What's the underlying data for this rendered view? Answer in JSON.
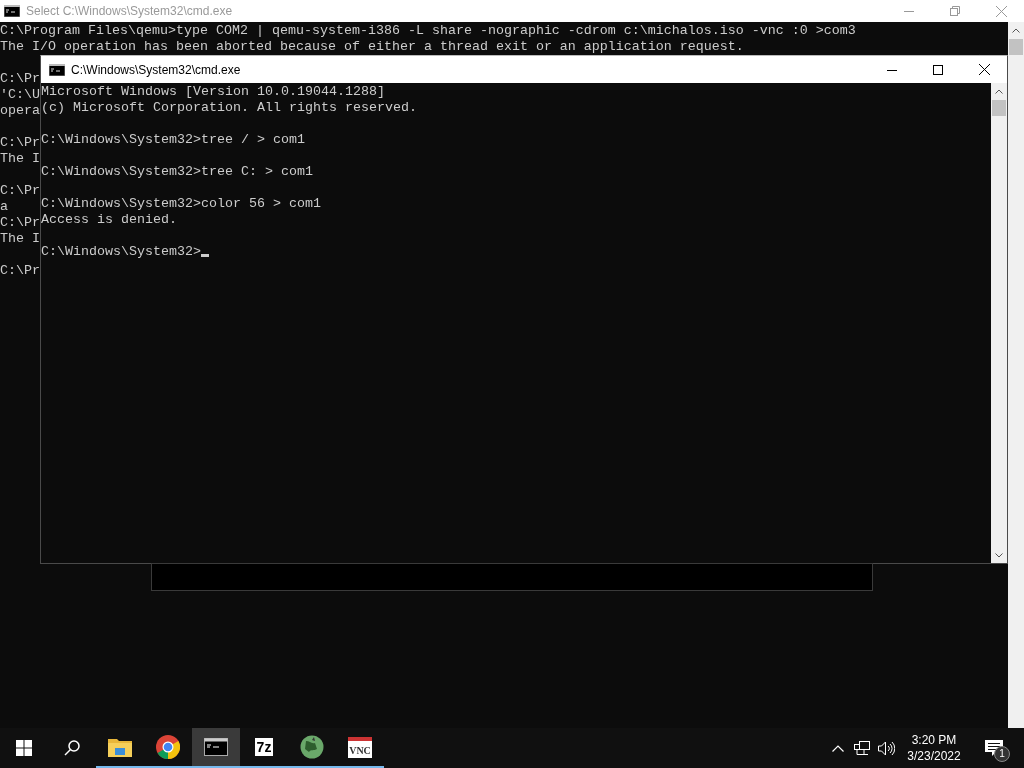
{
  "background_window": {
    "title": "Select C:\\Windows\\System32\\cmd.exe",
    "active": false,
    "blocks": [
      [
        "C:\\Program Files\\qemu>type COM2 | qemu-system-i386 -L share -nographic -cdrom c:\\michalos.iso -vnc :0 >com3",
        "The I/O operation has been aborted because of either a thread exit or an application request."
      ],
      [
        "C:\\Pr",
        "'C:\\U",
        "opera"
      ],
      [
        "C:\\Pr",
        "The I"
      ],
      [
        "C:\\Pr",
        "a",
        "C:\\Pr",
        "The I"
      ],
      [
        "C:\\Pr"
      ]
    ]
  },
  "front_window": {
    "title": "C:\\Windows\\System32\\cmd.exe",
    "active": true,
    "cursor": true,
    "blocks": [
      [
        "Microsoft Windows [Version 10.0.19044.1288]",
        "(c) Microsoft Corporation. All rights reserved."
      ],
      [
        "C:\\Windows\\System32>tree / > com1"
      ],
      [
        "C:\\Windows\\System32>tree C: > com1"
      ],
      [
        "C:\\Windows\\System32>color 56 > com1",
        "Access is denied."
      ],
      [
        "C:\\Windows\\System32>"
      ]
    ]
  },
  "taskbar": {
    "apps": [
      {
        "kind": "folder",
        "running": true,
        "selected": false
      },
      {
        "kind": "browser",
        "running": true,
        "selected": false
      },
      {
        "kind": "console",
        "running": true,
        "selected": true
      },
      {
        "kind": "archiver",
        "label": "7z",
        "running": true,
        "selected": false
      },
      {
        "kind": "globe",
        "running": true,
        "selected": false
      },
      {
        "kind": "vnc",
        "label": "VNC",
        "running": true,
        "selected": false
      }
    ],
    "time": "3:20 PM",
    "date": "3/23/2022",
    "notification_count": "1"
  }
}
